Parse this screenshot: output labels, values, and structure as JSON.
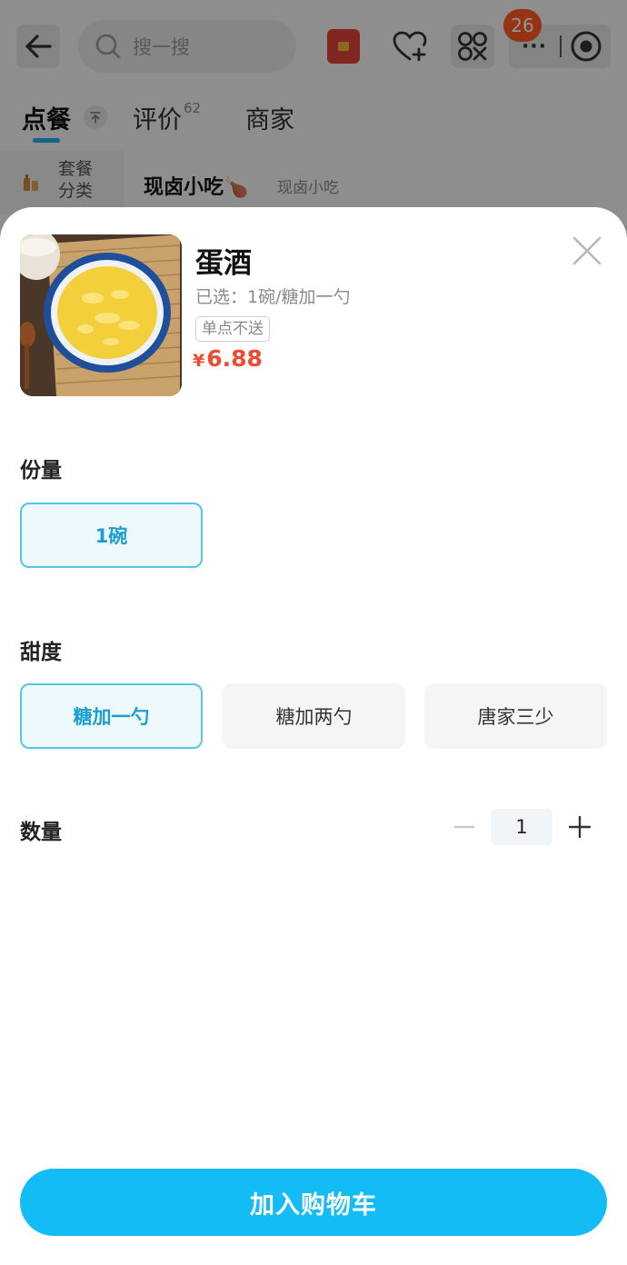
{
  "header": {
    "search_placeholder": "搜一搜",
    "notification_badge": "26",
    "capsule_more": "···",
    "icons": [
      "arrow-left-icon",
      "search-icon",
      "red-packet-icon",
      "heart-plus-icon",
      "mini-program-icon",
      "more-dots-icon",
      "record-circle-icon"
    ]
  },
  "tabs": [
    {
      "label": "点餐",
      "count": ""
    },
    {
      "label": "评价",
      "count": "62"
    },
    {
      "label": "商家",
      "count": ""
    }
  ],
  "menu": {
    "category_label": "套餐分类",
    "section_title": "现卤小吃🍗",
    "section_subtitle": "现卤小吃"
  },
  "product": {
    "name": "蛋酒",
    "selected": "已选：1碗/糖加一勺",
    "tag": "单点不送",
    "price_symbol": "¥",
    "price": "6.88",
    "price_color": "#ee4b2f"
  },
  "options": {
    "portion": {
      "label": "份量",
      "choices": [
        {
          "label": "1碗",
          "selected": true
        }
      ]
    },
    "sweetness": {
      "label": "甜度",
      "choices": [
        {
          "label": "糖加一勺",
          "selected": true
        },
        {
          "label": "糖加两勺",
          "selected": false
        },
        {
          "label": "唐家三少",
          "selected": false
        }
      ]
    }
  },
  "quantity": {
    "label": "数量",
    "value": "1"
  },
  "cart_button": {
    "label": "加入购物车",
    "color": "#14bcf5"
  },
  "colors": {
    "accent": "#1ab0e8",
    "selected_border": "#55c6e6",
    "badge": "#ff5a1f"
  }
}
